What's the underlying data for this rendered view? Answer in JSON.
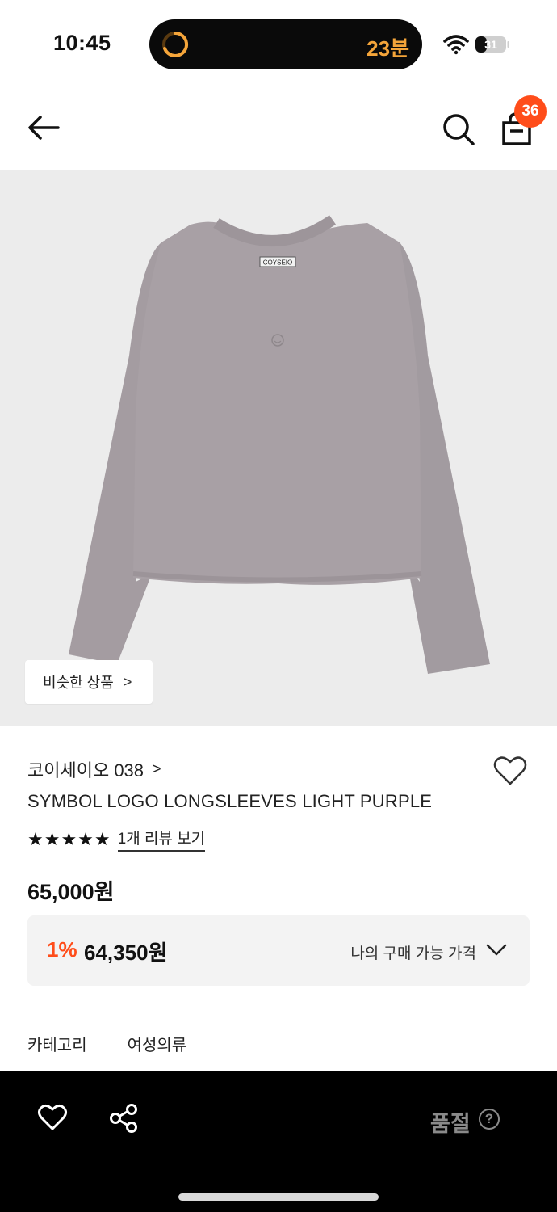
{
  "status_bar": {
    "time": "10:45",
    "timer_text": "23분",
    "battery": "31"
  },
  "header": {
    "cart_count": "36",
    "icons": [
      "back-arrow-icon",
      "search-icon",
      "shopping-bag-icon"
    ]
  },
  "image": {
    "similar_button": "비슷한 상품",
    "similar_chevron": ">",
    "tag_text": "COYSEIO"
  },
  "product": {
    "brand": "코이세이오 038",
    "brand_chevron": ">",
    "name": "SYMBOL LOGO LONGSLEEVES LIGHT PURPLE",
    "stars": "★★★★★",
    "rating": 5,
    "review_link": "1개 리뷰 보기",
    "price": "65,000원"
  },
  "discount": {
    "rate": "1%",
    "price": "64,350원",
    "label": "나의 구매 가능 가격"
  },
  "category": {
    "label": "카테고리",
    "value": "여성의류"
  },
  "bottom_bar": {
    "status": "품절",
    "help": "?"
  },
  "colors": {
    "accent": "#ff4d1a",
    "timer": "#f5a53a",
    "image_bg": "#ececec",
    "shirt": "#a59ea2"
  }
}
